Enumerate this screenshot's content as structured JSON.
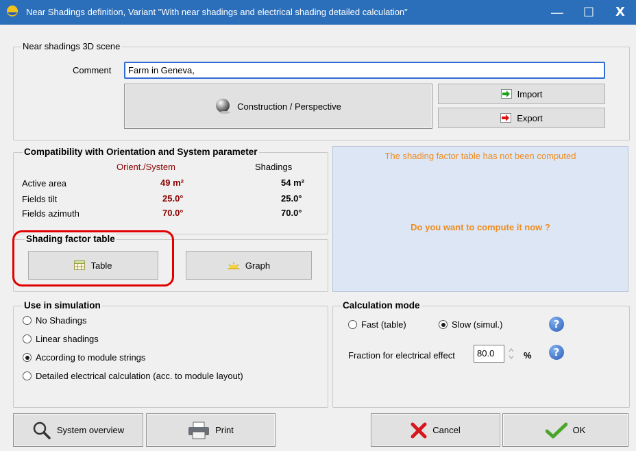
{
  "window": {
    "title": "Near Shadings definition, Variant \"With near shadings and electrical shading detailed calculation\"",
    "minimize": "—",
    "maximize": "☐",
    "close": "X"
  },
  "scene": {
    "legend": "Near shadings 3D scene",
    "comment_label": "Comment",
    "comment_value": "Farm in Geneva,",
    "construction_label": "Construction / Perspective",
    "import_label": "Import",
    "export_label": "Export"
  },
  "compat": {
    "legend": "Compatibility with Orientation and System parameter",
    "col_orient": "Orient./System",
    "col_shadings": "Shadings",
    "rows": [
      {
        "label": "Active area",
        "orient": "49 m²",
        "shadings": "54 m²"
      },
      {
        "label": "Fields tilt",
        "orient": "25.0°",
        "shadings": "25.0°"
      },
      {
        "label": "Fields azimuth",
        "orient": "70.0°",
        "shadings": "70.0°"
      }
    ]
  },
  "info_panel": {
    "message": "The shading factor table has not been computed",
    "question": "Do you want to compute it now ?"
  },
  "shading_table": {
    "legend": "Shading factor table",
    "table_label": "Table",
    "graph_label": "Graph"
  },
  "use_in_sim": {
    "legend": "Use in simulation",
    "options": [
      {
        "label": "No Shadings",
        "selected": false
      },
      {
        "label": "Linear shadings",
        "selected": false
      },
      {
        "label": "According to module strings",
        "selected": true
      },
      {
        "label": "Detailed electrical calculation (acc. to module layout)",
        "selected": false
      }
    ]
  },
  "calc_mode": {
    "legend": "Calculation mode",
    "fast_label": "Fast (table)",
    "slow_label": "Slow (simul.)",
    "selected": "slow",
    "fraction_label": "Fraction for electrical effect",
    "fraction_value": "80.0",
    "fraction_unit": "%",
    "help": "?"
  },
  "footer": {
    "system_overview": "System overview",
    "print": "Print",
    "cancel": "Cancel",
    "ok": "OK"
  },
  "colors": {
    "titlebar": "#2b6fba",
    "info_bg": "#dce6f5",
    "info_message": "#f08c1e",
    "value_red": "#8b0000",
    "highlight": "#e00000"
  }
}
